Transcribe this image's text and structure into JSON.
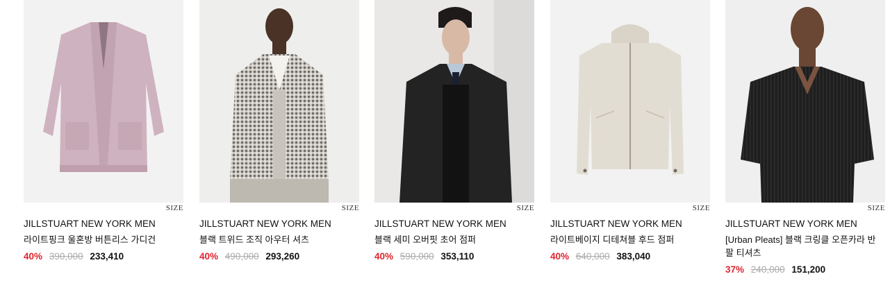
{
  "products": [
    {
      "brand": "JILLSTUART NEW YORK MEN",
      "name": "라이트핑크 울혼방 버튼리스 가디건",
      "discount": "40%",
      "original_price": "390,000",
      "sale_price": "233,410",
      "size_label": "SIZE",
      "image": "pink-cardigan-image"
    },
    {
      "brand": "JILLSTUART NEW YORK MEN",
      "name": "블랙 트위드 조직 아우터 셔츠",
      "discount": "40%",
      "original_price": "490,000",
      "sale_price": "293,260",
      "size_label": "SIZE",
      "image": "tweed-shirt-model-image"
    },
    {
      "brand": "JILLSTUART NEW YORK MEN",
      "name": "블랙 세미 오버핏 초어 점퍼",
      "discount": "40%",
      "original_price": "590,000",
      "sale_price": "353,110",
      "size_label": "SIZE",
      "image": "black-chore-jacket-model-image"
    },
    {
      "brand": "JILLSTUART NEW YORK MEN",
      "name": "라이트베이지 디테쳐블 후드 점퍼",
      "discount": "40%",
      "original_price": "640,000",
      "sale_price": "383,040",
      "size_label": "SIZE",
      "image": "beige-hood-jumper-image"
    },
    {
      "brand": "JILLSTUART NEW YORK MEN",
      "name": "[Urban Pleats] 블랙 크링클 오픈카라 반팔 티셔츠",
      "discount": "37%",
      "original_price": "240,000",
      "sale_price": "151,200",
      "size_label": "SIZE",
      "image": "black-pleats-tshirt-model-image"
    }
  ],
  "colors": {
    "discount": "#e0242e",
    "original_price": "#aaaaaa",
    "text": "#111111"
  }
}
